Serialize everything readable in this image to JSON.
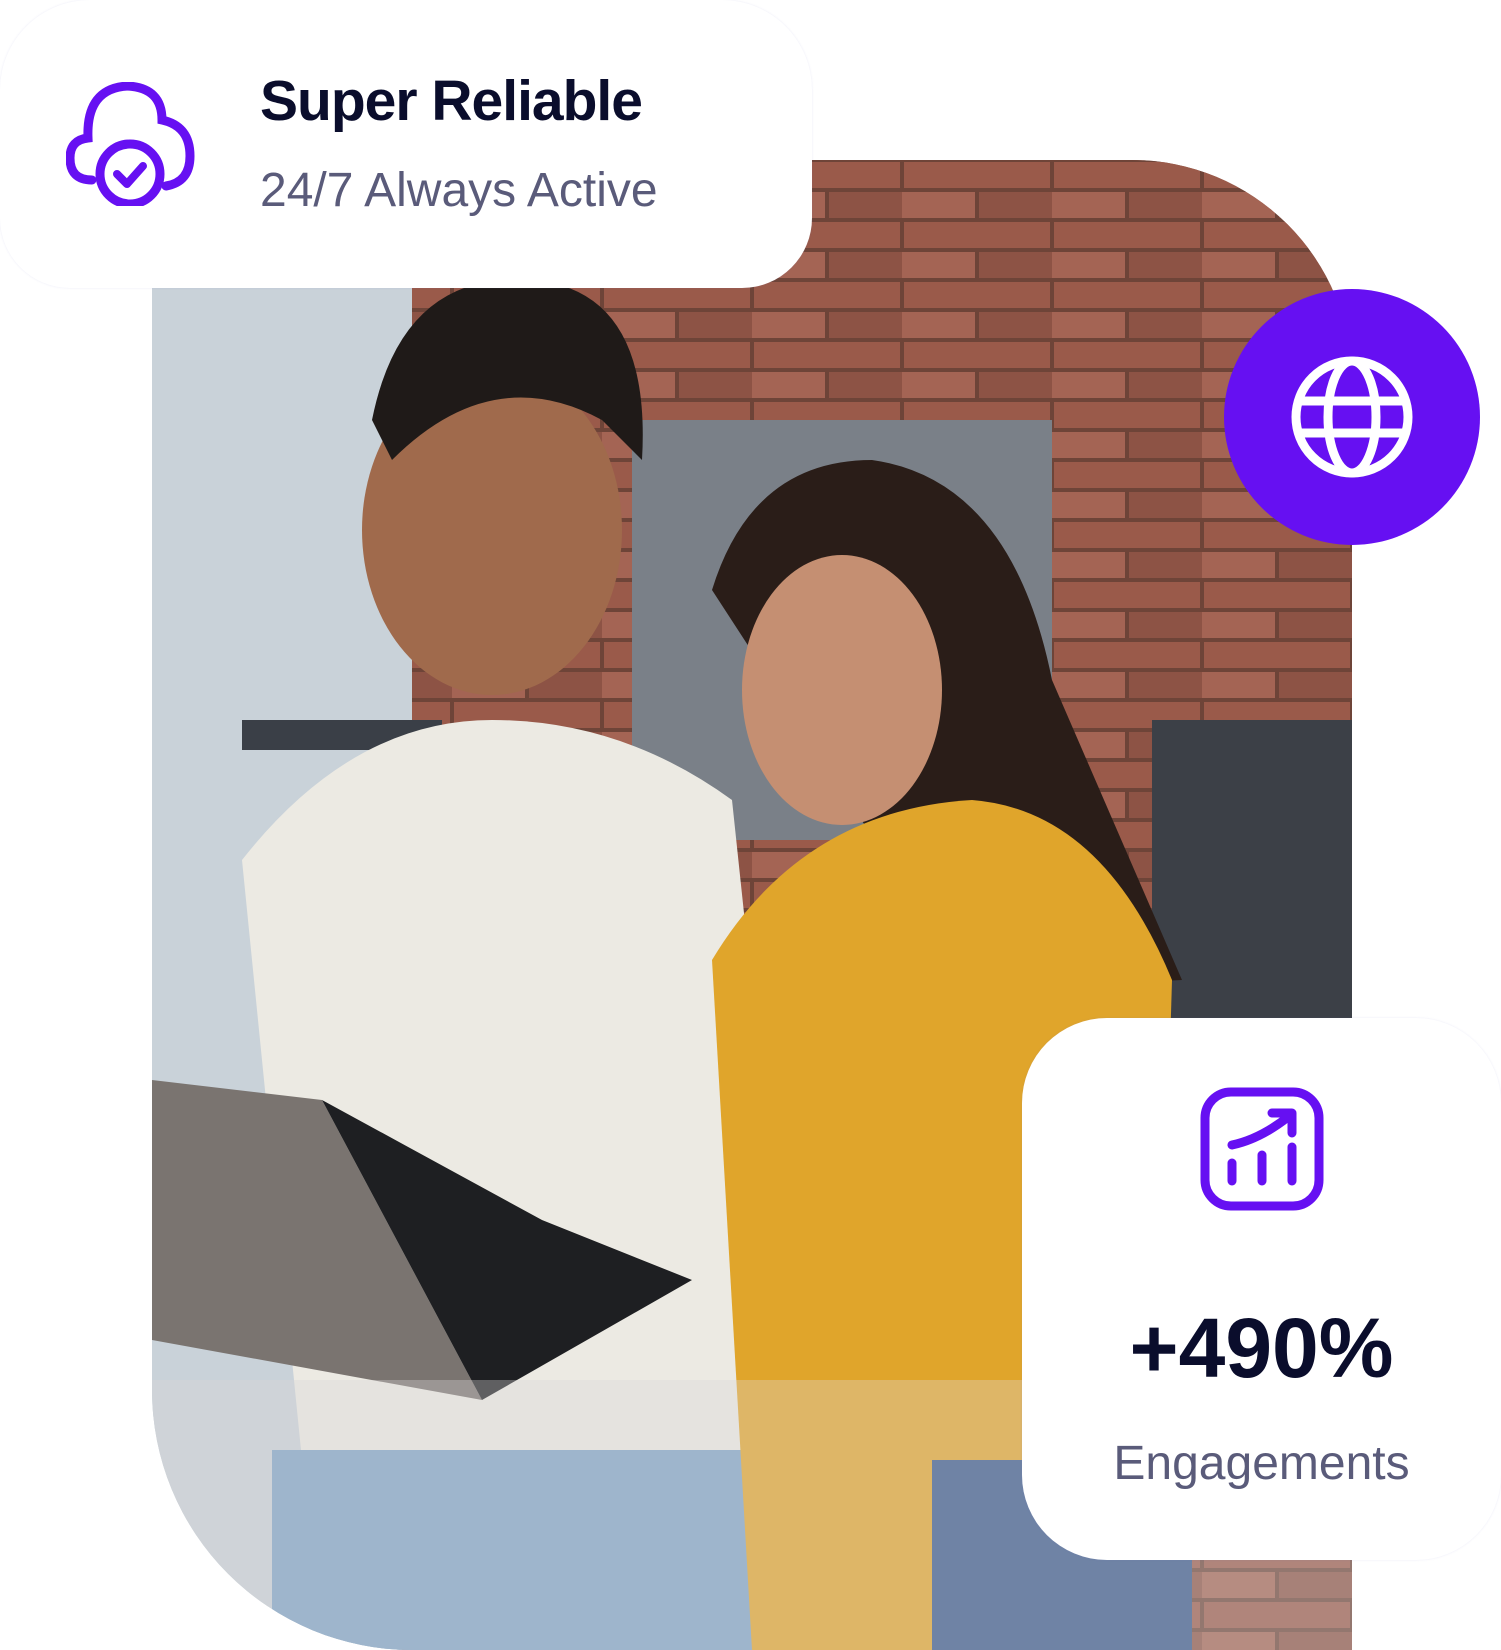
{
  "reliability_card": {
    "title": "Super Reliable",
    "subtitle": "24/7 Always Active",
    "icon": "cloud-check-icon"
  },
  "globe_badge": {
    "icon": "globe-icon"
  },
  "stats_card": {
    "value": "+490%",
    "label": "Engagements",
    "icon": "chart-growth-icon"
  },
  "photo": {
    "subject": "couple-with-laptop"
  },
  "colors": {
    "accent": "#6610f2",
    "heading": "#0a0d2c",
    "muted": "#5a5b7a"
  }
}
